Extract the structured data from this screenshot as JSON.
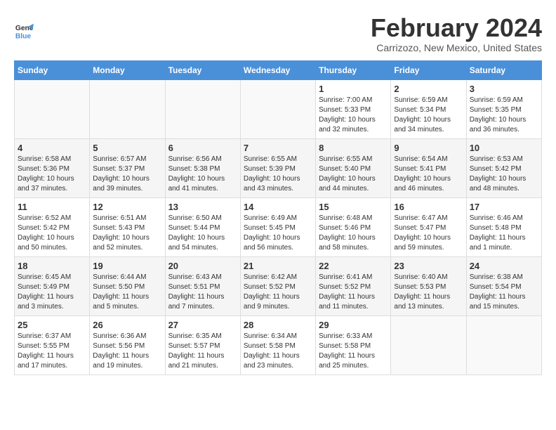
{
  "logo": {
    "line1": "General",
    "line2": "Blue"
  },
  "title": "February 2024",
  "subtitle": "Carrizozo, New Mexico, United States",
  "headers": [
    "Sunday",
    "Monday",
    "Tuesday",
    "Wednesday",
    "Thursday",
    "Friday",
    "Saturday"
  ],
  "weeks": [
    [
      {
        "day": "",
        "info": ""
      },
      {
        "day": "",
        "info": ""
      },
      {
        "day": "",
        "info": ""
      },
      {
        "day": "",
        "info": ""
      },
      {
        "day": "1",
        "info": "Sunrise: 7:00 AM\nSunset: 5:33 PM\nDaylight: 10 hours\nand 32 minutes."
      },
      {
        "day": "2",
        "info": "Sunrise: 6:59 AM\nSunset: 5:34 PM\nDaylight: 10 hours\nand 34 minutes."
      },
      {
        "day": "3",
        "info": "Sunrise: 6:59 AM\nSunset: 5:35 PM\nDaylight: 10 hours\nand 36 minutes."
      }
    ],
    [
      {
        "day": "4",
        "info": "Sunrise: 6:58 AM\nSunset: 5:36 PM\nDaylight: 10 hours\nand 37 minutes."
      },
      {
        "day": "5",
        "info": "Sunrise: 6:57 AM\nSunset: 5:37 PM\nDaylight: 10 hours\nand 39 minutes."
      },
      {
        "day": "6",
        "info": "Sunrise: 6:56 AM\nSunset: 5:38 PM\nDaylight: 10 hours\nand 41 minutes."
      },
      {
        "day": "7",
        "info": "Sunrise: 6:55 AM\nSunset: 5:39 PM\nDaylight: 10 hours\nand 43 minutes."
      },
      {
        "day": "8",
        "info": "Sunrise: 6:55 AM\nSunset: 5:40 PM\nDaylight: 10 hours\nand 44 minutes."
      },
      {
        "day": "9",
        "info": "Sunrise: 6:54 AM\nSunset: 5:41 PM\nDaylight: 10 hours\nand 46 minutes."
      },
      {
        "day": "10",
        "info": "Sunrise: 6:53 AM\nSunset: 5:42 PM\nDaylight: 10 hours\nand 48 minutes."
      }
    ],
    [
      {
        "day": "11",
        "info": "Sunrise: 6:52 AM\nSunset: 5:42 PM\nDaylight: 10 hours\nand 50 minutes."
      },
      {
        "day": "12",
        "info": "Sunrise: 6:51 AM\nSunset: 5:43 PM\nDaylight: 10 hours\nand 52 minutes."
      },
      {
        "day": "13",
        "info": "Sunrise: 6:50 AM\nSunset: 5:44 PM\nDaylight: 10 hours\nand 54 minutes."
      },
      {
        "day": "14",
        "info": "Sunrise: 6:49 AM\nSunset: 5:45 PM\nDaylight: 10 hours\nand 56 minutes."
      },
      {
        "day": "15",
        "info": "Sunrise: 6:48 AM\nSunset: 5:46 PM\nDaylight: 10 hours\nand 58 minutes."
      },
      {
        "day": "16",
        "info": "Sunrise: 6:47 AM\nSunset: 5:47 PM\nDaylight: 10 hours\nand 59 minutes."
      },
      {
        "day": "17",
        "info": "Sunrise: 6:46 AM\nSunset: 5:48 PM\nDaylight: 11 hours\nand 1 minute."
      }
    ],
    [
      {
        "day": "18",
        "info": "Sunrise: 6:45 AM\nSunset: 5:49 PM\nDaylight: 11 hours\nand 3 minutes."
      },
      {
        "day": "19",
        "info": "Sunrise: 6:44 AM\nSunset: 5:50 PM\nDaylight: 11 hours\nand 5 minutes."
      },
      {
        "day": "20",
        "info": "Sunrise: 6:43 AM\nSunset: 5:51 PM\nDaylight: 11 hours\nand 7 minutes."
      },
      {
        "day": "21",
        "info": "Sunrise: 6:42 AM\nSunset: 5:52 PM\nDaylight: 11 hours\nand 9 minutes."
      },
      {
        "day": "22",
        "info": "Sunrise: 6:41 AM\nSunset: 5:52 PM\nDaylight: 11 hours\nand 11 minutes."
      },
      {
        "day": "23",
        "info": "Sunrise: 6:40 AM\nSunset: 5:53 PM\nDaylight: 11 hours\nand 13 minutes."
      },
      {
        "day": "24",
        "info": "Sunrise: 6:38 AM\nSunset: 5:54 PM\nDaylight: 11 hours\nand 15 minutes."
      }
    ],
    [
      {
        "day": "25",
        "info": "Sunrise: 6:37 AM\nSunset: 5:55 PM\nDaylight: 11 hours\nand 17 minutes."
      },
      {
        "day": "26",
        "info": "Sunrise: 6:36 AM\nSunset: 5:56 PM\nDaylight: 11 hours\nand 19 minutes."
      },
      {
        "day": "27",
        "info": "Sunrise: 6:35 AM\nSunset: 5:57 PM\nDaylight: 11 hours\nand 21 minutes."
      },
      {
        "day": "28",
        "info": "Sunrise: 6:34 AM\nSunset: 5:58 PM\nDaylight: 11 hours\nand 23 minutes."
      },
      {
        "day": "29",
        "info": "Sunrise: 6:33 AM\nSunset: 5:58 PM\nDaylight: 11 hours\nand 25 minutes."
      },
      {
        "day": "",
        "info": ""
      },
      {
        "day": "",
        "info": ""
      }
    ]
  ]
}
